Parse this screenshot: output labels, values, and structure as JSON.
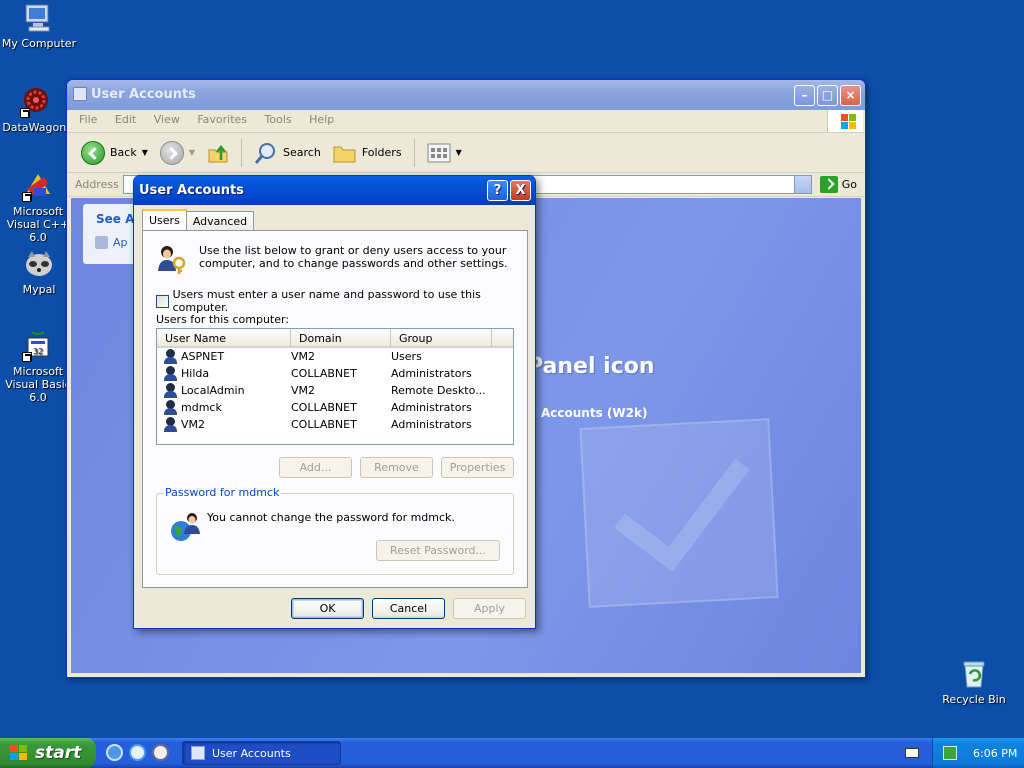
{
  "desktop": {
    "icons": [
      {
        "label": "My Computer"
      },
      {
        "label": "DataWagon."
      },
      {
        "label": "Microsoft Visual C++ 6.0"
      },
      {
        "label": "Mypal"
      },
      {
        "label": "Microsoft Visual Basic 6.0"
      },
      {
        "label": "Recycle Bin"
      }
    ]
  },
  "window": {
    "title": "User Accounts",
    "menu": [
      "File",
      "Edit",
      "View",
      "Favorites",
      "Tools",
      "Help"
    ],
    "toolbar": {
      "back": "Back",
      "search": "Search",
      "folders": "Folders"
    },
    "address_label": "Address",
    "go_label": "Go",
    "sidebar": {
      "title": "See Als",
      "link": "Ap"
    },
    "background_title": "Panel icon",
    "background_subtitle": "Accounts (W2k)"
  },
  "dialog": {
    "title": "User Accounts",
    "help_label": "?",
    "close_label": "X",
    "tabs": [
      "Users",
      "Advanced"
    ],
    "active_tab": "Users",
    "intro": "Use the list below to grant or deny users access to your computer, and to change passwords and other settings.",
    "require_login_label": "Users must enter a user name and password to use this computer.",
    "users_label": "Users for this computer:",
    "columns": [
      "User Name",
      "Domain",
      "Group"
    ],
    "users": [
      {
        "name": "ASPNET",
        "domain": "VM2",
        "group": "Users"
      },
      {
        "name": "Hilda",
        "domain": "COLLABNET",
        "group": "Administrators"
      },
      {
        "name": "LocalAdmin",
        "domain": "VM2",
        "group": "Remote Deskto..."
      },
      {
        "name": "mdmck",
        "domain": "COLLABNET",
        "group": "Administrators"
      },
      {
        "name": "VM2",
        "domain": "COLLABNET",
        "group": "Administrators"
      }
    ],
    "buttons": {
      "add": "Add...",
      "remove": "Remove",
      "properties": "Properties"
    },
    "password_group": {
      "legend": "Password for mdmck",
      "message": "You cannot change the password for mdmck.",
      "reset_label": "Reset Password..."
    },
    "footer": {
      "ok": "OK",
      "cancel": "Cancel",
      "apply": "Apply"
    }
  },
  "taskbar": {
    "start_label": "start",
    "task_label": "User Accounts",
    "time": "6:06 PM"
  },
  "colors": {
    "desktop": "#0c4ea8",
    "taskbar": "#245edb",
    "start": "#3a9a3a",
    "title_active": "#0453d9"
  }
}
